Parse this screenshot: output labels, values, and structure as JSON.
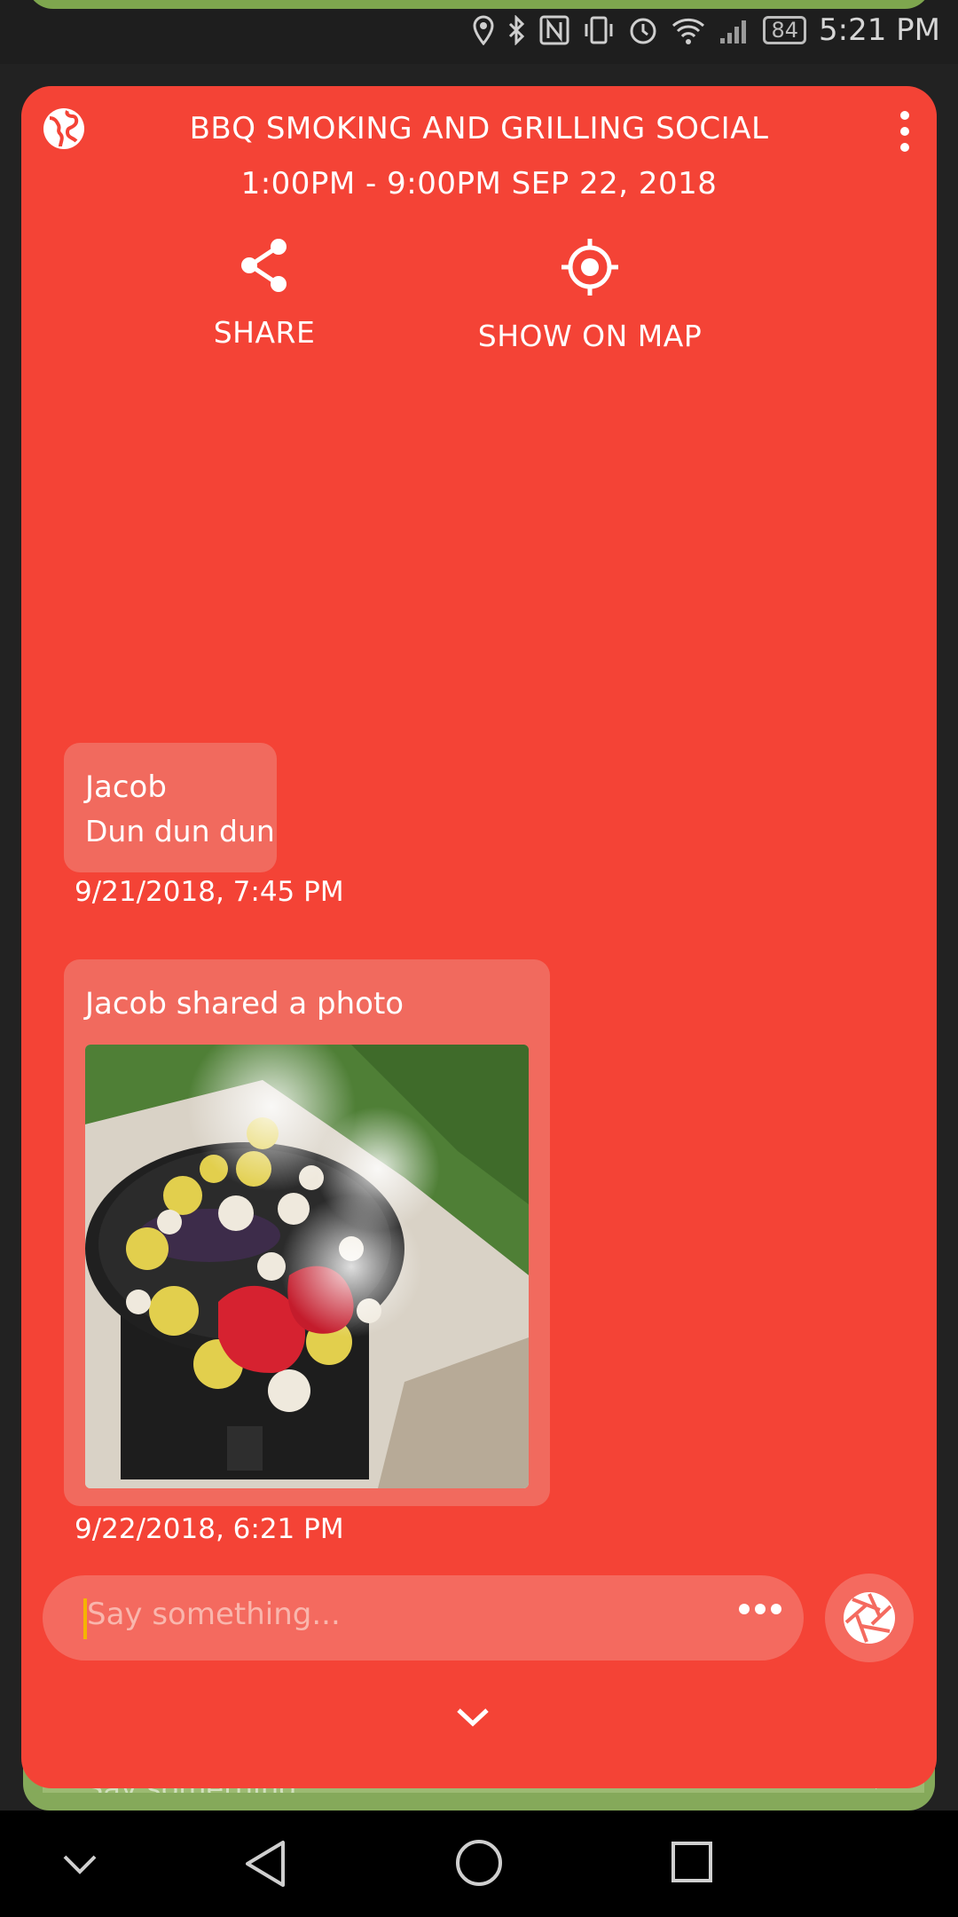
{
  "status_bar": {
    "time": "5:21 PM",
    "battery": "84"
  },
  "event": {
    "title": "BBQ SMOKING AND GRILLING SOCIAL",
    "time_range": "1:00PM - 9:00PM SEP 22, 2018"
  },
  "actions": {
    "share": "SHARE",
    "show_on_map": "SHOW ON MAP"
  },
  "messages": [
    {
      "name": "Jacob",
      "text": "Dun dun dun",
      "timestamp": "9/21/2018, 7:45 PM"
    },
    {
      "name": "Jacob shared a photo",
      "timestamp": "9/22/2018, 6:21 PM"
    }
  ],
  "composer": {
    "placeholder": "Say something..."
  },
  "background_sheet": {
    "placeholder": "Say something..."
  },
  "colors": {
    "card": "#f44336",
    "bubble": "#f16a5e",
    "background_sheet": "#85a95a"
  },
  "icons": [
    "globe-icon",
    "more-vert-icon",
    "share-icon",
    "gps-target-icon",
    "more-horiz-icon",
    "camera-shutter-icon",
    "chevron-down-icon"
  ]
}
